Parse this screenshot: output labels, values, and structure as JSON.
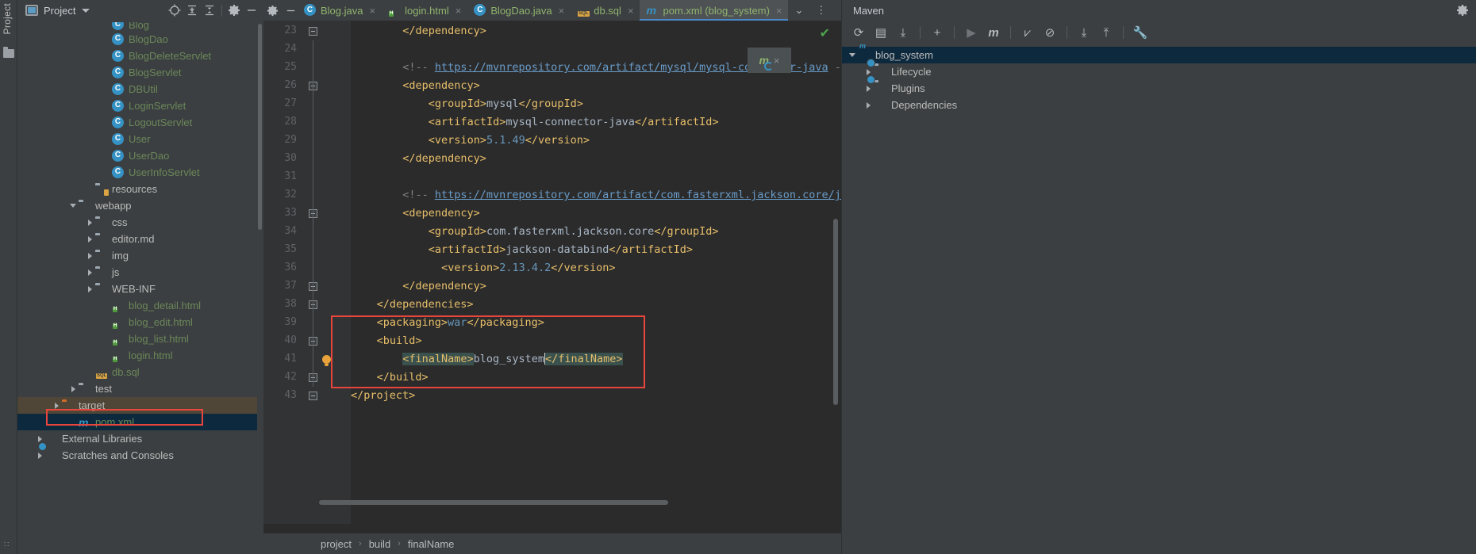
{
  "app": {
    "left_strip_label": "Project",
    "left_strip_bottom": "∷"
  },
  "project_panel": {
    "title": "Project",
    "icons": {
      "window_icon": "project-window-icon",
      "dropdown": "chevron-down-icon",
      "locate": "crosshair-locate-icon",
      "expand_all": "expand-all-icon",
      "collapse_all": "collapse-all-icon",
      "settings": "gear-icon",
      "hide": "minimize-icon"
    },
    "tree": [
      {
        "label": "Blog",
        "kind": "class",
        "indent": 5,
        "twist": "none",
        "clipped": true
      },
      {
        "label": "BlogDao",
        "kind": "class",
        "indent": 5,
        "twist": "none"
      },
      {
        "label": "BlogDeleteServlet",
        "kind": "class",
        "indent": 5,
        "twist": "none"
      },
      {
        "label": "BlogServlet",
        "kind": "class",
        "indent": 5,
        "twist": "none"
      },
      {
        "label": "DBUtil",
        "kind": "class",
        "indent": 5,
        "twist": "none"
      },
      {
        "label": "LoginServlet",
        "kind": "class",
        "indent": 5,
        "twist": "none"
      },
      {
        "label": "LogoutServlet",
        "kind": "class",
        "indent": 5,
        "twist": "none"
      },
      {
        "label": "User",
        "kind": "class",
        "indent": 5,
        "twist": "none"
      },
      {
        "label": "UserDao",
        "kind": "class",
        "indent": 5,
        "twist": "none"
      },
      {
        "label": "UserInfoServlet",
        "kind": "class",
        "indent": 5,
        "twist": "none"
      },
      {
        "label": "resources",
        "kind": "folder-resources",
        "indent": 4,
        "twist": "none"
      },
      {
        "label": "webapp",
        "kind": "folder",
        "indent": 3,
        "twist": "open"
      },
      {
        "label": "css",
        "kind": "folder",
        "indent": 4,
        "twist": "closed"
      },
      {
        "label": "editor.md",
        "kind": "folder",
        "indent": 4,
        "twist": "closed"
      },
      {
        "label": "img",
        "kind": "folder",
        "indent": 4,
        "twist": "closed"
      },
      {
        "label": "js",
        "kind": "folder",
        "indent": 4,
        "twist": "closed"
      },
      {
        "label": "WEB-INF",
        "kind": "folder",
        "indent": 4,
        "twist": "closed"
      },
      {
        "label": "blog_detail.html",
        "kind": "html",
        "indent": 5,
        "twist": "none"
      },
      {
        "label": "blog_edit.html",
        "kind": "html",
        "indent": 5,
        "twist": "none"
      },
      {
        "label": "blog_list.html",
        "kind": "html",
        "indent": 5,
        "twist": "none"
      },
      {
        "label": "login.html",
        "kind": "html",
        "indent": 5,
        "twist": "none"
      },
      {
        "label": "db.sql",
        "kind": "sql",
        "indent": 4,
        "twist": "none"
      },
      {
        "label": "test",
        "kind": "folder",
        "indent": 3,
        "twist": "closed"
      },
      {
        "label": "target",
        "kind": "folder-orange",
        "indent": 2,
        "twist": "closed",
        "state": "excluded"
      },
      {
        "label": "pom.xml",
        "kind": "maven",
        "indent": 3,
        "twist": "none",
        "state": "selected",
        "annotated": true
      },
      {
        "label": "External Libraries",
        "kind": "libraries",
        "indent": 1,
        "twist": "closed"
      },
      {
        "label": "Scratches and Consoles",
        "kind": "scratches",
        "indent": 1,
        "twist": "closed"
      }
    ]
  },
  "editor": {
    "tabs": [
      {
        "label": "Blog.java",
        "kind": "class",
        "active": false
      },
      {
        "label": "login.html",
        "kind": "html",
        "active": false
      },
      {
        "label": "BlogDao.java",
        "kind": "class",
        "active": false
      },
      {
        "label": "db.sql",
        "kind": "sql",
        "active": false
      },
      {
        "label": "pom.xml (blog_system)",
        "kind": "maven",
        "active": true
      }
    ],
    "tab_close_glyph": "×",
    "tab_overflow_glyph": "⌄",
    "tab_options_glyph": "⋮",
    "inspection_status": "✔",
    "lines": [
      {
        "n": 23,
        "indent": 8,
        "html": "<span class='tagc'>&lt;/dependency&gt;</span>"
      },
      {
        "n": 24,
        "indent": 0,
        "html": ""
      },
      {
        "n": 25,
        "indent": 8,
        "html": "<span class='cmt'>&lt;!-- </span><span class='lnk'>https://mvnrepository.com/artifact/mysql/mysql-connector-java</span><span class='cmt'> --&gt;</span>"
      },
      {
        "n": 26,
        "indent": 8,
        "html": "<span class='tagc'>&lt;dependency&gt;</span>"
      },
      {
        "n": 27,
        "indent": 12,
        "html": "<span class='tagc'>&lt;groupId&gt;</span><span class='txtc'>mysql</span><span class='tagc'>&lt;/groupId&gt;</span>"
      },
      {
        "n": 28,
        "indent": 12,
        "html": "<span class='tagc'>&lt;artifactId&gt;</span><span class='txtc'>mysql-connector-java</span><span class='tagc'>&lt;/artifactId&gt;</span>"
      },
      {
        "n": 29,
        "indent": 12,
        "html": "<span class='tagc'>&lt;version&gt;</span><span class='numv'>5.1.49</span><span class='tagc'>&lt;/version&gt;</span>"
      },
      {
        "n": 30,
        "indent": 8,
        "html": "<span class='tagc'>&lt;/dependency&gt;</span>"
      },
      {
        "n": 31,
        "indent": 0,
        "html": ""
      },
      {
        "n": 32,
        "indent": 8,
        "html": "<span class='cmt'>&lt;!-- </span><span class='lnk'>https://mvnrepository.com/artifact/com.fasterxml.jackson.core/jac</span>"
      },
      {
        "n": 33,
        "indent": 8,
        "html": "<span class='tagc'>&lt;dependency&gt;</span>"
      },
      {
        "n": 34,
        "indent": 12,
        "html": "<span class='tagc'>&lt;groupId&gt;</span><span class='txtc'>com.fasterxml.jackson.core</span><span class='tagc'>&lt;/groupId&gt;</span>"
      },
      {
        "n": 35,
        "indent": 12,
        "html": "<span class='tagc'>&lt;artifactId&gt;</span><span class='txtc'>jackson-databind</span><span class='tagc'>&lt;/artifactId&gt;</span>"
      },
      {
        "n": 36,
        "indent": 14,
        "html": "<span class='tagc'>&lt;version&gt;</span><span class='numv'>2.13.4.2</span><span class='tagc'>&lt;/version&gt;</span>"
      },
      {
        "n": 37,
        "indent": 8,
        "html": "<span class='tagc'>&lt;/dependency&gt;</span>"
      },
      {
        "n": 38,
        "indent": 4,
        "html": "<span class='tagc'>&lt;/dependencies&gt;</span>"
      },
      {
        "n": 39,
        "indent": 4,
        "html": "<span class='tagc'>&lt;packaging&gt;</span><span class='strv'>war</span><span class='tagc'>&lt;/packaging&gt;</span>"
      },
      {
        "n": 40,
        "indent": 4,
        "html": "<span class='tagc'>&lt;build&gt;</span>"
      },
      {
        "n": 41,
        "indent": 8,
        "html": "<span class='hl-sel tagc'>&lt;finalName&gt;</span><span class='txtc'>blog_system</span><span class='caret'></span><span class='hl-sel tagc'>&lt;/finalName&gt;</span>"
      },
      {
        "n": 42,
        "indent": 4,
        "html": "<span class='tagc'>&lt;/build&gt;</span>"
      },
      {
        "n": 43,
        "indent": 0,
        "html": "<span class='tagc'>&lt;/project&gt;</span>"
      }
    ],
    "breadcrumbs": [
      "project",
      "build",
      "finalName"
    ],
    "breadcrumb_separator": "›"
  },
  "maven_popup": {
    "icon": "maven-reload-icon",
    "close_glyph": "×"
  },
  "maven_panel": {
    "title": "Maven",
    "toolbar": [
      {
        "name": "reload-all-maven-projects-icon",
        "glyph": "⟳"
      },
      {
        "name": "generate-sources-icon",
        "glyph": "▤"
      },
      {
        "name": "download-sources-icon",
        "glyph": "⤓"
      },
      {
        "name": "add-maven-project-icon",
        "glyph": "+"
      },
      {
        "name": "execute-goal-icon",
        "glyph": "▶"
      },
      {
        "name": "run-maven-build-icon",
        "glyph": "m"
      },
      {
        "name": "toggle-skip-tests-icon",
        "glyph": "⩗"
      },
      {
        "name": "toggle-offline-mode-icon",
        "glyph": "⊘"
      },
      {
        "name": "expand-all-icon",
        "glyph": "⤓"
      },
      {
        "name": "collapse-all-icon",
        "glyph": "⤒"
      },
      {
        "name": "maven-settings-icon",
        "glyph": "🔧"
      }
    ],
    "tree": [
      {
        "label": "blog_system",
        "kind": "maven-project",
        "indent": 0,
        "twist": "open",
        "state": "selected"
      },
      {
        "label": "Lifecycle",
        "kind": "maven-folder",
        "indent": 1,
        "twist": "closed"
      },
      {
        "label": "Plugins",
        "kind": "maven-folder",
        "indent": 1,
        "twist": "closed"
      },
      {
        "label": "Dependencies",
        "kind": "maven-deps",
        "indent": 1,
        "twist": "closed"
      }
    ],
    "settings_icon": "gear-icon"
  },
  "colors": {
    "accent_blue": "#3592c4",
    "selection_blue": "#0d293e",
    "annotation_red": "#e8453c",
    "excluded_brown": "#4f4637",
    "string_green": "#6a8759"
  }
}
